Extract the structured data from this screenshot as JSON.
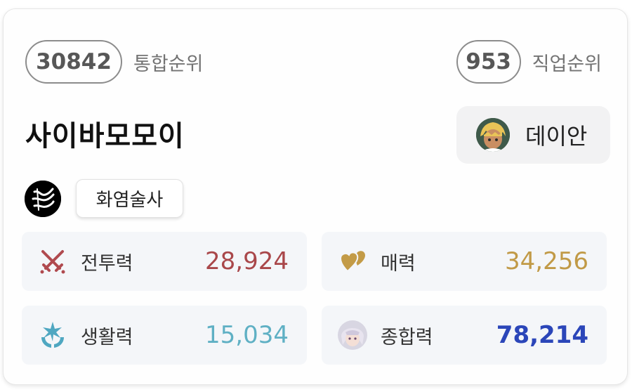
{
  "ranks": {
    "overall": {
      "value": "30842",
      "label": "통합순위"
    },
    "job": {
      "value": "953",
      "label": "직업순위"
    }
  },
  "character": {
    "name": "사이바모모이",
    "world": "데이안",
    "job": "화염술사"
  },
  "stats": {
    "combat": {
      "label": "전투력",
      "value": "28,924",
      "color": "#a9474a",
      "icon": "crossed-swords-icon"
    },
    "charm": {
      "label": "매력",
      "value": "34,256",
      "color": "#c19a47",
      "icon": "hearts-icon"
    },
    "life": {
      "label": "생활력",
      "value": "15,034",
      "color": "#5fb0c4",
      "icon": "sparkle-hands-icon"
    },
    "total": {
      "label": "종합력",
      "value": "78,214",
      "color": "#2b46b9",
      "icon": "character-portrait-icon"
    }
  }
}
